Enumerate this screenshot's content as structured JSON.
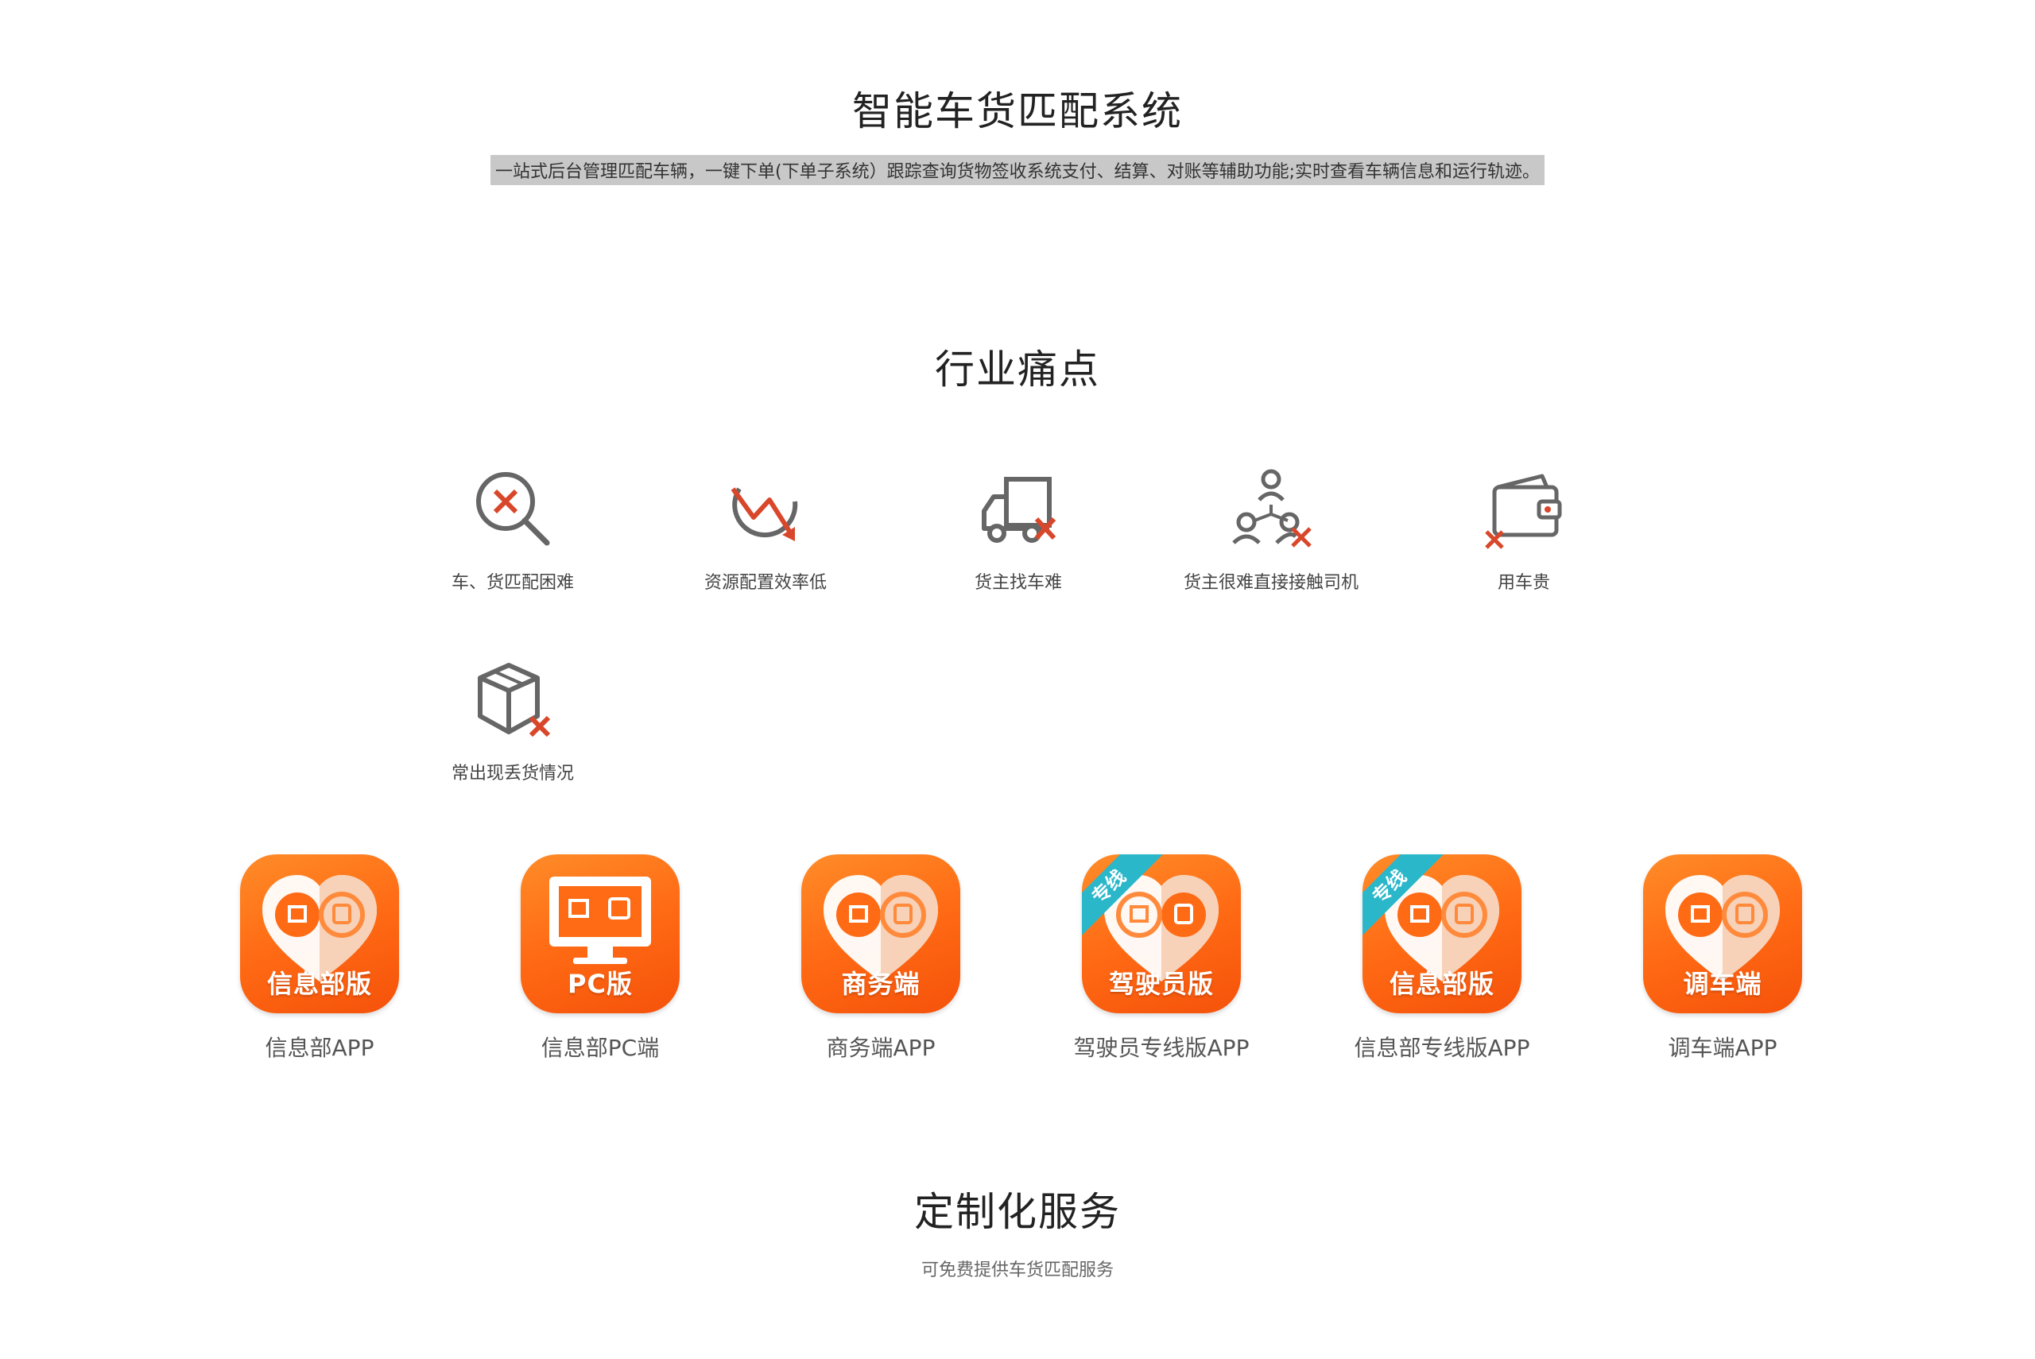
{
  "header": {
    "title": "智能车货匹配系统",
    "intro": "一站式后台管理匹配车辆，一键下单(下单子系统）跟踪查询货物签收系统支付、结算、对账等辅助功能;实时查看车辆信息和运行轨迹。"
  },
  "pain_points": {
    "title": "行业痛点",
    "items": [
      {
        "label": "车、货匹配困难",
        "icon": "magnifier-x-icon"
      },
      {
        "label": "资源配置效率低",
        "icon": "declining-arrow-icon"
      },
      {
        "label": "货主找车难",
        "icon": "truck-x-icon"
      },
      {
        "label": "货主很难直接接触司机",
        "icon": "people-network-x-icon"
      },
      {
        "label": "用车贵",
        "icon": "wallet-x-icon"
      },
      {
        "label": "常出现丢货情况",
        "icon": "box-x-icon"
      }
    ],
    "accent_color": "#d9472b",
    "icon_color": "#666666"
  },
  "apps": {
    "brand_color": "#ff6a14",
    "ribbon_color": "#2ab7c9",
    "items": [
      {
        "tile_label": "信息部版",
        "caption": "信息部APP",
        "ribbon": ""
      },
      {
        "tile_label": "PC版",
        "caption": "信息部PC端",
        "ribbon": ""
      },
      {
        "tile_label": "商务端",
        "caption": "商务端APP",
        "ribbon": ""
      },
      {
        "tile_label": "驾驶员版",
        "caption": "驾驶员专线版APP",
        "ribbon": "专线"
      },
      {
        "tile_label": "信息部版",
        "caption": "信息部专线版APP",
        "ribbon": "专线"
      },
      {
        "tile_label": "调车端",
        "caption": "调车端APP",
        "ribbon": ""
      }
    ]
  },
  "custom": {
    "title": "定制化服务",
    "subtitle": "可免费提供车货匹配服务"
  }
}
